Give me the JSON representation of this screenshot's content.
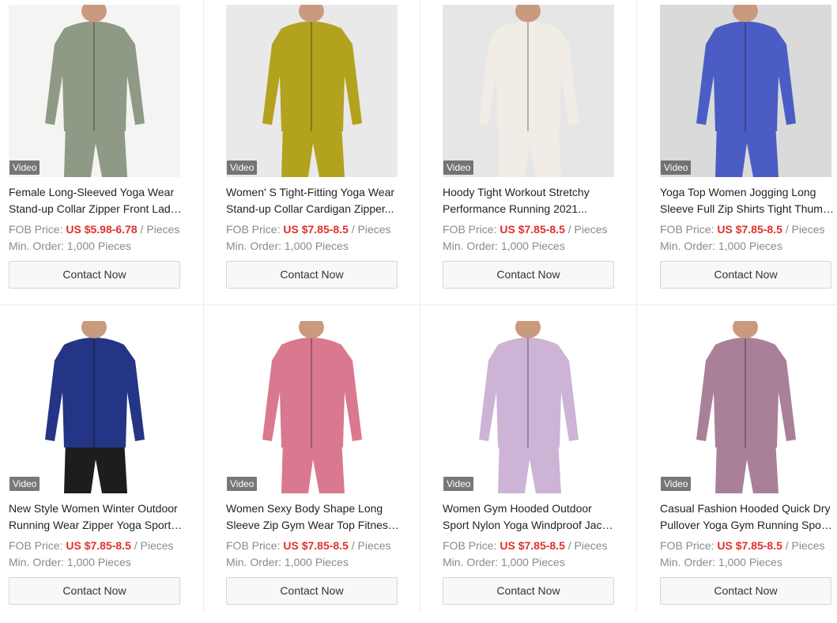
{
  "products": [
    {
      "title_line1": "Female Long-Sleeved Yoga Wear",
      "title_line2": "Stand-up Collar Zipper Front Lady...",
      "fob_label": "FOB Price:",
      "price": "US $5.98-6.78",
      "unit": "/ Pieces",
      "min_order": "Min. Order: 1,000 Pieces",
      "badge": "Video",
      "button": "Contact Now",
      "garment_color": "#8f9a86",
      "bg_color": "#f4f4f2"
    },
    {
      "title_line1": "Women' S Tight-Fitting Yoga Wear",
      "title_line2": "Stand-up Collar Cardigan Zipper...",
      "fob_label": "FOB Price:",
      "price": "US $7.85-8.5",
      "unit": "/ Pieces",
      "min_order": "Min. Order: 1,000 Pieces",
      "badge": "Video",
      "button": "Contact Now",
      "garment_color": "#b3a21e",
      "bg_color": "#e9e9e9"
    },
    {
      "title_line1": "Hoody Tight Workout Stretchy",
      "title_line2": "Performance Running 2021...",
      "fob_label": "FOB Price:",
      "price": "US $7.85-8.5",
      "unit": "/ Pieces",
      "min_order": "Min. Order: 1,000 Pieces",
      "badge": "Video",
      "button": "Contact Now",
      "garment_color": "#f1ede6",
      "bg_color": "#e6e6e6"
    },
    {
      "title_line1": "Yoga Top Women Jogging Long",
      "title_line2": "Sleeve Full Zip Shirts Tight Thumb...",
      "fob_label": "FOB Price:",
      "price": "US $7.85-8.5",
      "unit": "/ Pieces",
      "min_order": "Min. Order: 1,000 Pieces",
      "badge": "Video",
      "button": "Contact Now",
      "garment_color": "#4b5dc4",
      "bg_color": "#dadada"
    },
    {
      "title_line1": "New Style Women Winter Outdoor",
      "title_line2": "Running Wear Zipper Yoga Sports...",
      "fob_label": "FOB Price:",
      "price": "US $7.85-8.5",
      "unit": "/ Pieces",
      "min_order": "Min. Order: 1,000 Pieces",
      "badge": "Video",
      "button": "Contact Now",
      "garment_color": "#243585",
      "bg_color": "#ffffff"
    },
    {
      "title_line1": "Women Sexy Body Shape Long",
      "title_line2": "Sleeve Zip Gym Wear Top Fitness...",
      "fob_label": "FOB Price:",
      "price": "US $7.85-8.5",
      "unit": "/ Pieces",
      "min_order": "Min. Order: 1,000 Pieces",
      "badge": "Video",
      "button": "Contact Now",
      "garment_color": "#d9788e",
      "bg_color": "#ffffff"
    },
    {
      "title_line1": "Women Gym Hooded Outdoor",
      "title_line2": "Sport Nylon Yoga Windproof Jack...",
      "fob_label": "FOB Price:",
      "price": "US $7.85-8.5",
      "unit": "/ Pieces",
      "min_order": "Min. Order: 1,000 Pieces",
      "badge": "Video",
      "button": "Contact Now",
      "garment_color": "#cdb3d6",
      "bg_color": "#ffffff"
    },
    {
      "title_line1": "Casual Fashion Hooded Quick Dry",
      "title_line2": "Pullover Yoga Gym Running Sport...",
      "fob_label": "FOB Price:",
      "price": "US $7.85-8.5",
      "unit": "/ Pieces",
      "min_order": "Min. Order: 1,000 Pieces",
      "badge": "Video",
      "button": "Contact Now",
      "garment_color": "#a98098",
      "bg_color": "#ffffff"
    }
  ]
}
